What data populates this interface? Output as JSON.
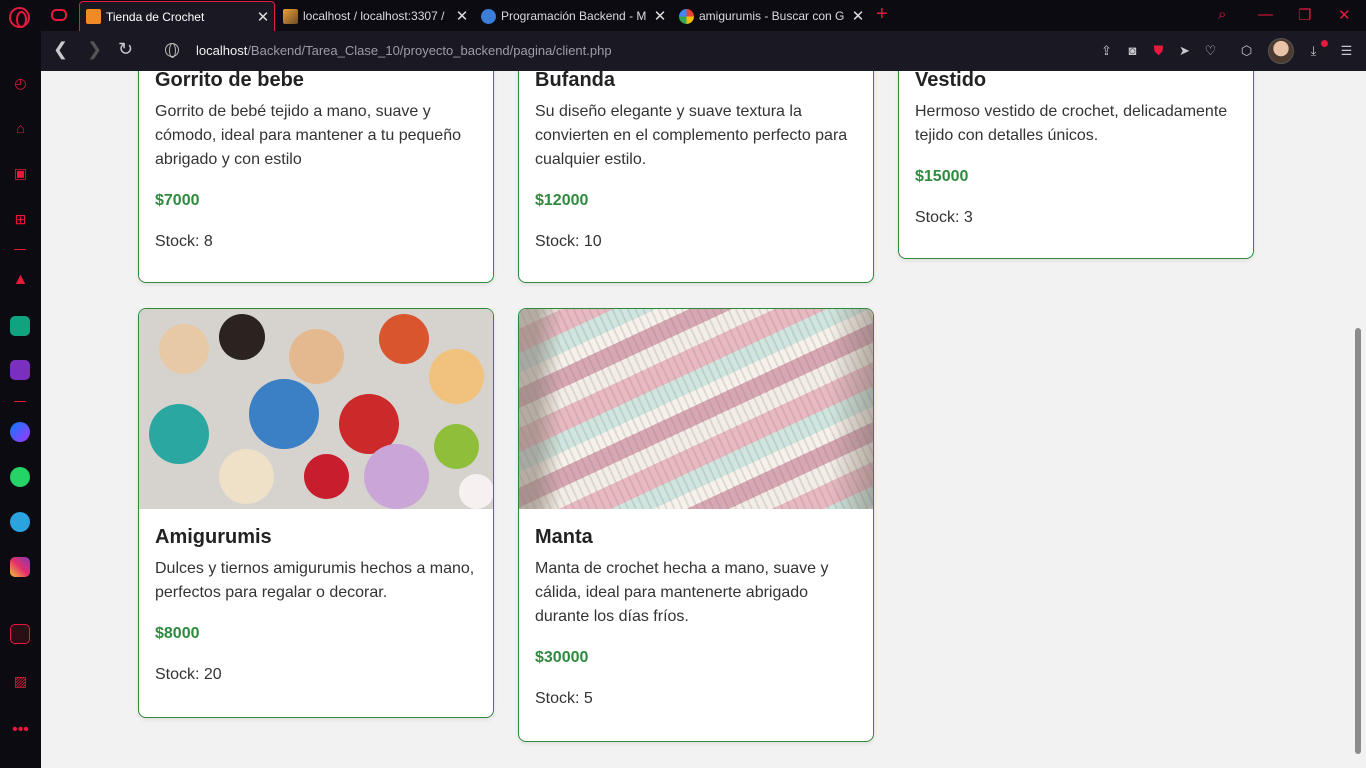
{
  "browser": {
    "tabs": [
      {
        "title": "Tienda de Crochet",
        "active": true
      },
      {
        "title": "localhost / localhost:3307 /",
        "active": false
      },
      {
        "title": "Programación Backend - M",
        "active": false
      },
      {
        "title": "amigurumis - Buscar con G",
        "active": false
      }
    ],
    "url_host": "localhost",
    "url_path": "/Backend/Tarea_Clase_10/proyecto_backend/pagina/client.php",
    "accent_color": "#e8193c"
  },
  "products": [
    {
      "name": "Gorrito de bebe",
      "description": "Gorrito de bebé tejido a mano, suave y cómodo, ideal para mantener a tu pequeño abrigado y con estilo",
      "price": "$7000",
      "stock": "Stock: 8"
    },
    {
      "name": "Bufanda",
      "description": "Su diseño elegante y suave textura la convierten en el complemento perfecto para cualquier estilo.",
      "price": "$12000",
      "stock": "Stock: 10"
    },
    {
      "name": "Vestido",
      "description": "Hermoso vestido de crochet, delicadamente tejido con detalles únicos.",
      "price": "$15000",
      "stock": "Stock: 3"
    },
    {
      "name": "Amigurumis",
      "description": "Dulces y tiernos amigurumis hechos a mano, perfectos para regalar o decorar.",
      "price": "$8000",
      "stock": "Stock: 20"
    },
    {
      "name": "Manta",
      "description": "Manta de crochet hecha a mano, suave y cálida, ideal para mantenerte abrigado durante los días fríos.",
      "price": "$30000",
      "stock": "Stock: 5"
    }
  ],
  "colors": {
    "price": "#2e8b3e",
    "card_border": "#2e8b3e",
    "page_bg": "#f3f2f2"
  }
}
